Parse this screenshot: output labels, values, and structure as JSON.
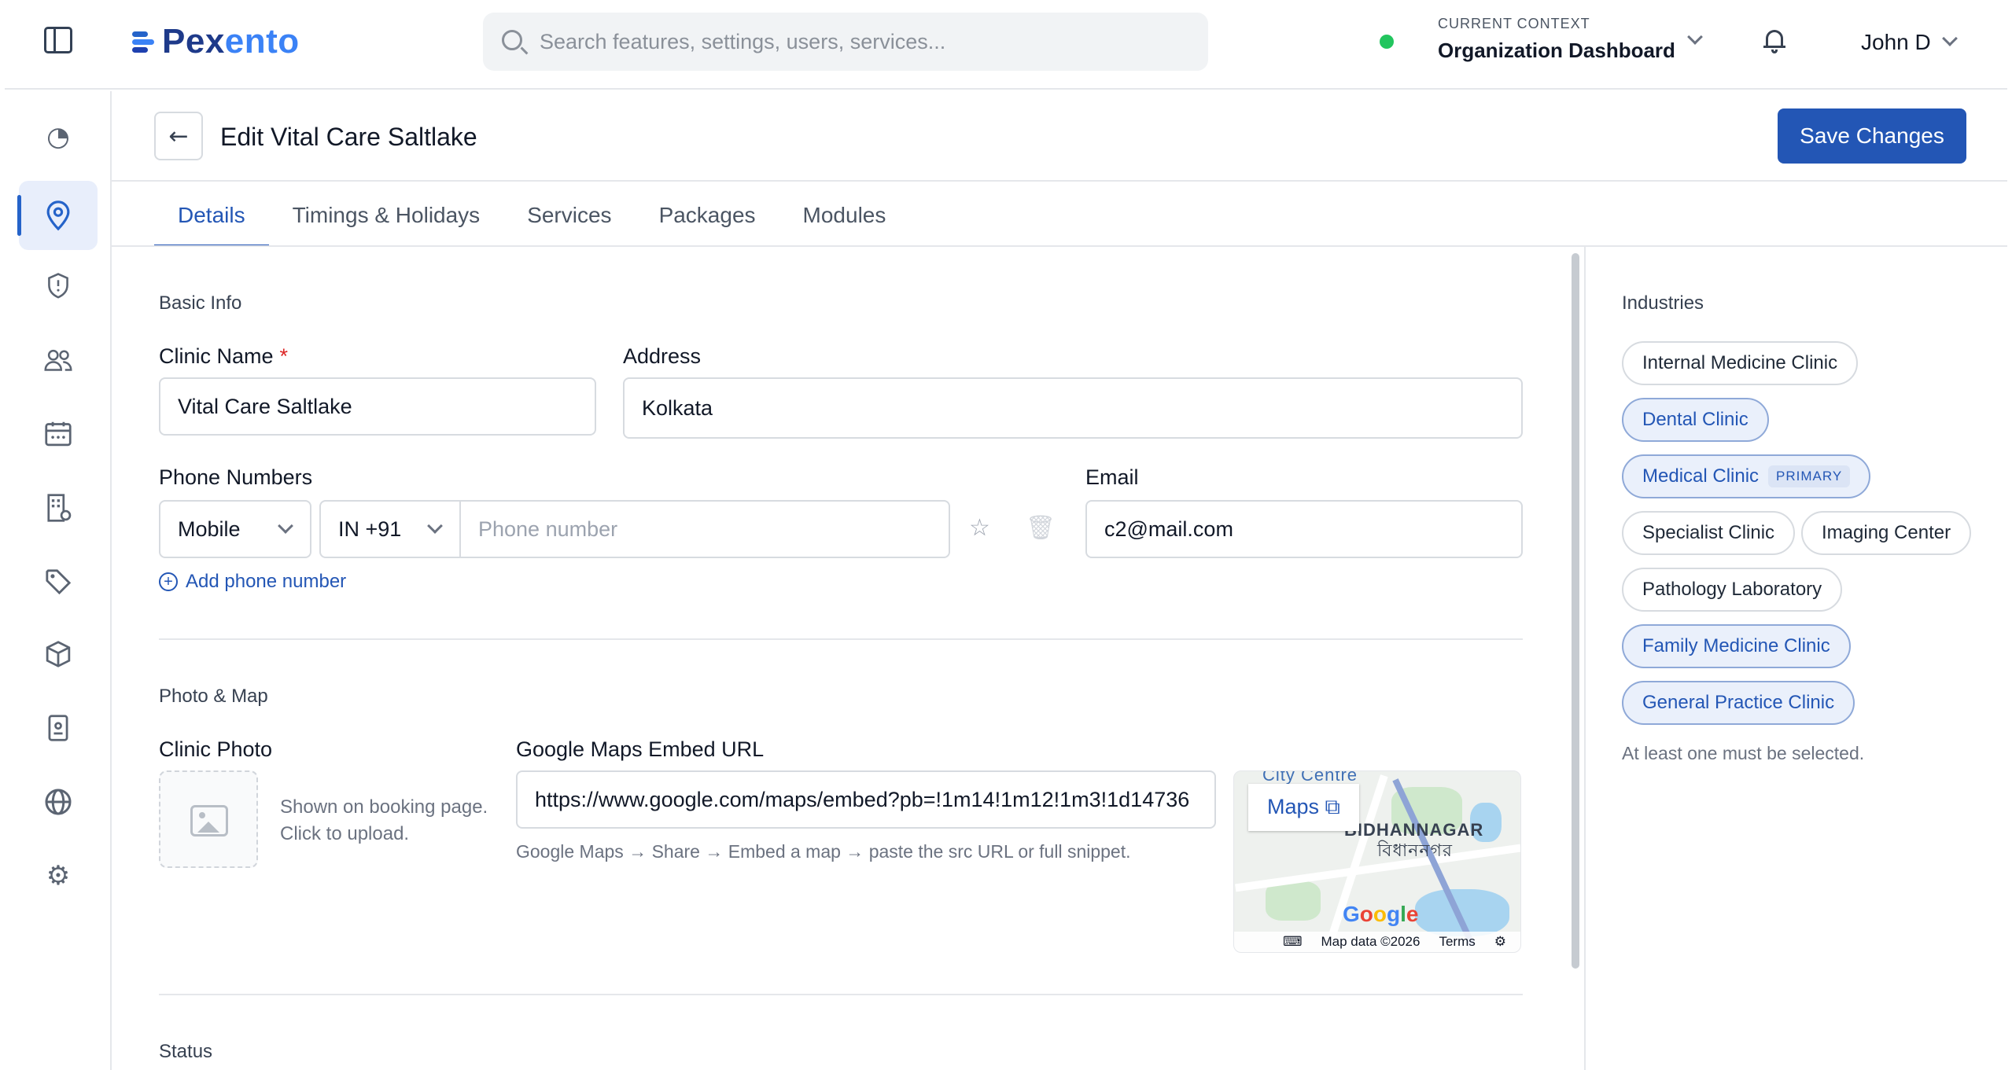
{
  "header": {
    "brand": {
      "prefix": "Pex",
      "suffix": "ento"
    },
    "search_placeholder": "Search features, settings, users, services...",
    "context_label": "CURRENT CONTEXT",
    "context_value": "Organization Dashboard",
    "user_name": "John D",
    "status_color": "#22c55e"
  },
  "nav": {
    "icons": [
      "dashboard-icon",
      "location-pin-icon",
      "shield-icon",
      "users-icon",
      "calendar-icon",
      "building-icon",
      "tag-icon",
      "package-box-icon",
      "clipboard-icon",
      "globe-icon",
      "gear-icon"
    ],
    "active": "location-pin-icon"
  },
  "page": {
    "title": "Edit Vital Care Saltlake",
    "save_label": "Save Changes",
    "tabs": [
      {
        "label": "Details",
        "active": true
      },
      {
        "label": "Timings & Holidays",
        "active": false
      },
      {
        "label": "Services",
        "active": false
      },
      {
        "label": "Packages",
        "active": false
      },
      {
        "label": "Modules",
        "active": false
      }
    ]
  },
  "basic_info": {
    "section_label": "Basic Info",
    "clinic_name_label": "Clinic Name",
    "required_mark": "*",
    "clinic_name_value": "Vital Care Saltlake",
    "address_label": "Address",
    "address_value": "Kolkata",
    "phone_label": "Phone Numbers",
    "phone_type": "Mobile",
    "phone_country": "IN +91",
    "phone_placeholder": "Phone number",
    "email_label": "Email",
    "email_value": "c2@mail.com",
    "add_phone_label": "Add phone number"
  },
  "photo_map": {
    "section_label": "Photo & Map",
    "clinic_photo_label": "Clinic Photo",
    "photo_hint_line1": "Shown on booking page.",
    "photo_hint_line2": "Click to upload.",
    "maps_label": "Google Maps Embed URL",
    "maps_value": "https://www.google.com/maps/embed?pb=!1m14!1m12!1m3!1d14736",
    "maps_hint": "Google Maps → Share → Embed a map → paste the src URL or full snippet.",
    "map_button": "Maps",
    "map_place_top": "City Centre",
    "map_place_en": "BIDHANNAGAR",
    "map_place_bn": "বিধাননগর",
    "map_logo": "Google",
    "map_attribution": "Map data ©2026",
    "map_terms": "Terms"
  },
  "status": {
    "section_label": "Status"
  },
  "industries": {
    "section_label": "Industries",
    "chips": [
      {
        "label": "Internal Medicine Clinic",
        "selected": false
      },
      {
        "label": "Dental Clinic",
        "selected": true
      },
      {
        "label": "Medical Clinic",
        "selected": true,
        "badge": "PRIMARY"
      },
      {
        "label": "Specialist Clinic",
        "selected": false
      },
      {
        "label": "Imaging Center",
        "selected": false
      },
      {
        "label": "Pathology Laboratory",
        "selected": false
      },
      {
        "label": "Family Medicine Clinic",
        "selected": true
      },
      {
        "label": "General Practice Clinic",
        "selected": true
      }
    ],
    "helper": "At least one must be selected."
  }
}
